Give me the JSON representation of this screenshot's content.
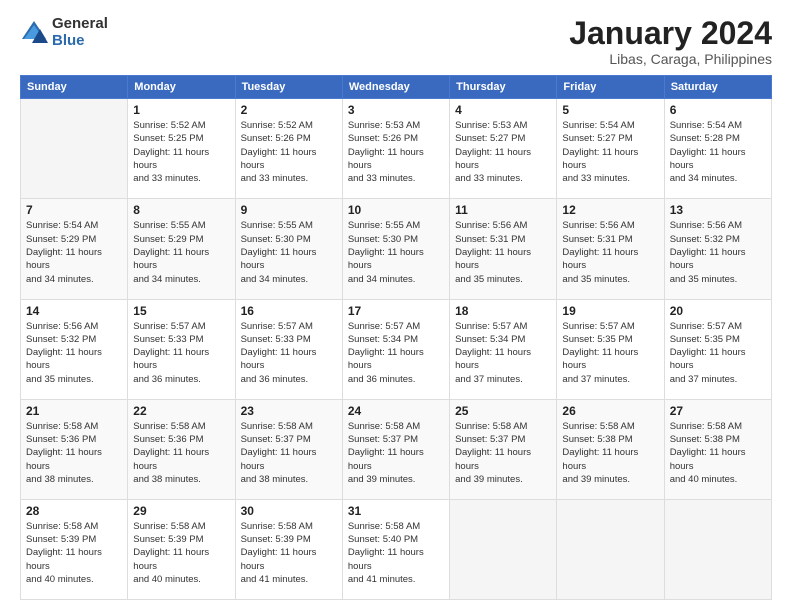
{
  "header": {
    "logo_general": "General",
    "logo_blue": "Blue",
    "title": "January 2024",
    "location": "Libas, Caraga, Philippines"
  },
  "days_of_week": [
    "Sunday",
    "Monday",
    "Tuesday",
    "Wednesday",
    "Thursday",
    "Friday",
    "Saturday"
  ],
  "weeks": [
    [
      {
        "day": "",
        "sunrise": "",
        "sunset": "",
        "daylight": ""
      },
      {
        "day": "1",
        "sunrise": "Sunrise: 5:52 AM",
        "sunset": "Sunset: 5:25 PM",
        "daylight": "Daylight: 11 hours and 33 minutes."
      },
      {
        "day": "2",
        "sunrise": "Sunrise: 5:52 AM",
        "sunset": "Sunset: 5:26 PM",
        "daylight": "Daylight: 11 hours and 33 minutes."
      },
      {
        "day": "3",
        "sunrise": "Sunrise: 5:53 AM",
        "sunset": "Sunset: 5:26 PM",
        "daylight": "Daylight: 11 hours and 33 minutes."
      },
      {
        "day": "4",
        "sunrise": "Sunrise: 5:53 AM",
        "sunset": "Sunset: 5:27 PM",
        "daylight": "Daylight: 11 hours and 33 minutes."
      },
      {
        "day": "5",
        "sunrise": "Sunrise: 5:54 AM",
        "sunset": "Sunset: 5:27 PM",
        "daylight": "Daylight: 11 hours and 33 minutes."
      },
      {
        "day": "6",
        "sunrise": "Sunrise: 5:54 AM",
        "sunset": "Sunset: 5:28 PM",
        "daylight": "Daylight: 11 hours and 34 minutes."
      }
    ],
    [
      {
        "day": "7",
        "sunrise": "Sunrise: 5:54 AM",
        "sunset": "Sunset: 5:29 PM",
        "daylight": "Daylight: 11 hours and 34 minutes."
      },
      {
        "day": "8",
        "sunrise": "Sunrise: 5:55 AM",
        "sunset": "Sunset: 5:29 PM",
        "daylight": "Daylight: 11 hours and 34 minutes."
      },
      {
        "day": "9",
        "sunrise": "Sunrise: 5:55 AM",
        "sunset": "Sunset: 5:30 PM",
        "daylight": "Daylight: 11 hours and 34 minutes."
      },
      {
        "day": "10",
        "sunrise": "Sunrise: 5:55 AM",
        "sunset": "Sunset: 5:30 PM",
        "daylight": "Daylight: 11 hours and 34 minutes."
      },
      {
        "day": "11",
        "sunrise": "Sunrise: 5:56 AM",
        "sunset": "Sunset: 5:31 PM",
        "daylight": "Daylight: 11 hours and 35 minutes."
      },
      {
        "day": "12",
        "sunrise": "Sunrise: 5:56 AM",
        "sunset": "Sunset: 5:31 PM",
        "daylight": "Daylight: 11 hours and 35 minutes."
      },
      {
        "day": "13",
        "sunrise": "Sunrise: 5:56 AM",
        "sunset": "Sunset: 5:32 PM",
        "daylight": "Daylight: 11 hours and 35 minutes."
      }
    ],
    [
      {
        "day": "14",
        "sunrise": "Sunrise: 5:56 AM",
        "sunset": "Sunset: 5:32 PM",
        "daylight": "Daylight: 11 hours and 35 minutes."
      },
      {
        "day": "15",
        "sunrise": "Sunrise: 5:57 AM",
        "sunset": "Sunset: 5:33 PM",
        "daylight": "Daylight: 11 hours and 36 minutes."
      },
      {
        "day": "16",
        "sunrise": "Sunrise: 5:57 AM",
        "sunset": "Sunset: 5:33 PM",
        "daylight": "Daylight: 11 hours and 36 minutes."
      },
      {
        "day": "17",
        "sunrise": "Sunrise: 5:57 AM",
        "sunset": "Sunset: 5:34 PM",
        "daylight": "Daylight: 11 hours and 36 minutes."
      },
      {
        "day": "18",
        "sunrise": "Sunrise: 5:57 AM",
        "sunset": "Sunset: 5:34 PM",
        "daylight": "Daylight: 11 hours and 37 minutes."
      },
      {
        "day": "19",
        "sunrise": "Sunrise: 5:57 AM",
        "sunset": "Sunset: 5:35 PM",
        "daylight": "Daylight: 11 hours and 37 minutes."
      },
      {
        "day": "20",
        "sunrise": "Sunrise: 5:57 AM",
        "sunset": "Sunset: 5:35 PM",
        "daylight": "Daylight: 11 hours and 37 minutes."
      }
    ],
    [
      {
        "day": "21",
        "sunrise": "Sunrise: 5:58 AM",
        "sunset": "Sunset: 5:36 PM",
        "daylight": "Daylight: 11 hours and 38 minutes."
      },
      {
        "day": "22",
        "sunrise": "Sunrise: 5:58 AM",
        "sunset": "Sunset: 5:36 PM",
        "daylight": "Daylight: 11 hours and 38 minutes."
      },
      {
        "day": "23",
        "sunrise": "Sunrise: 5:58 AM",
        "sunset": "Sunset: 5:37 PM",
        "daylight": "Daylight: 11 hours and 38 minutes."
      },
      {
        "day": "24",
        "sunrise": "Sunrise: 5:58 AM",
        "sunset": "Sunset: 5:37 PM",
        "daylight": "Daylight: 11 hours and 39 minutes."
      },
      {
        "day": "25",
        "sunrise": "Sunrise: 5:58 AM",
        "sunset": "Sunset: 5:37 PM",
        "daylight": "Daylight: 11 hours and 39 minutes."
      },
      {
        "day": "26",
        "sunrise": "Sunrise: 5:58 AM",
        "sunset": "Sunset: 5:38 PM",
        "daylight": "Daylight: 11 hours and 39 minutes."
      },
      {
        "day": "27",
        "sunrise": "Sunrise: 5:58 AM",
        "sunset": "Sunset: 5:38 PM",
        "daylight": "Daylight: 11 hours and 40 minutes."
      }
    ],
    [
      {
        "day": "28",
        "sunrise": "Sunrise: 5:58 AM",
        "sunset": "Sunset: 5:39 PM",
        "daylight": "Daylight: 11 hours and 40 minutes."
      },
      {
        "day": "29",
        "sunrise": "Sunrise: 5:58 AM",
        "sunset": "Sunset: 5:39 PM",
        "daylight": "Daylight: 11 hours and 40 minutes."
      },
      {
        "day": "30",
        "sunrise": "Sunrise: 5:58 AM",
        "sunset": "Sunset: 5:39 PM",
        "daylight": "Daylight: 11 hours and 41 minutes."
      },
      {
        "day": "31",
        "sunrise": "Sunrise: 5:58 AM",
        "sunset": "Sunset: 5:40 PM",
        "daylight": "Daylight: 11 hours and 41 minutes."
      },
      {
        "day": "",
        "sunrise": "",
        "sunset": "",
        "daylight": ""
      },
      {
        "day": "",
        "sunrise": "",
        "sunset": "",
        "daylight": ""
      },
      {
        "day": "",
        "sunrise": "",
        "sunset": "",
        "daylight": ""
      }
    ]
  ]
}
